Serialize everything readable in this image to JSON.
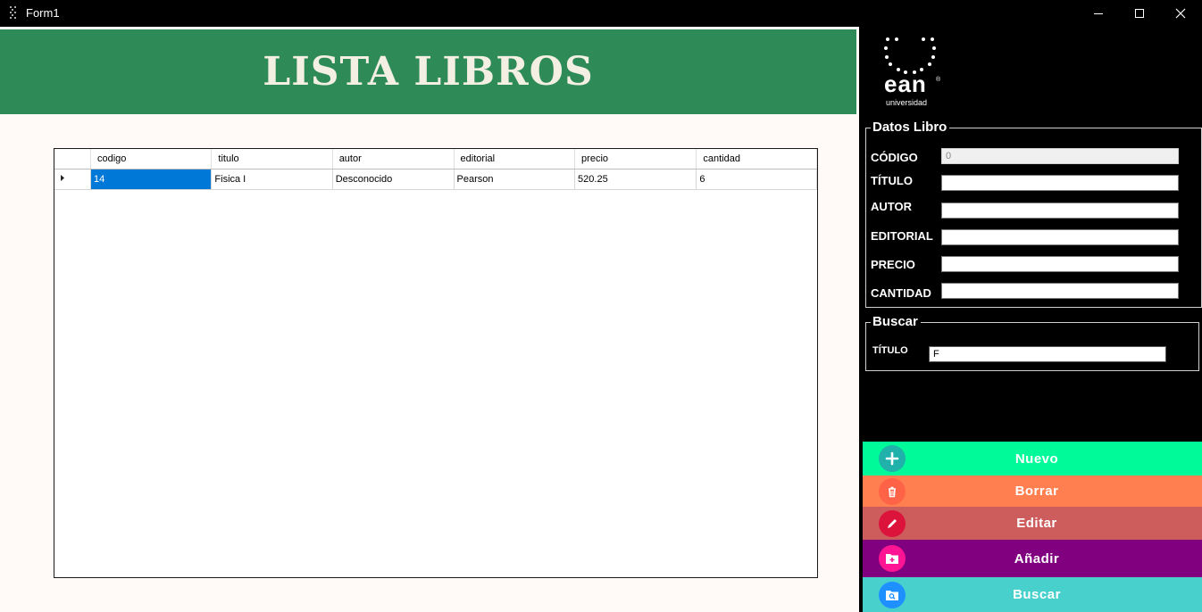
{
  "window": {
    "title": "Form1",
    "icon": "form-app-icon",
    "controls": [
      "minimize-icon",
      "maximize-icon",
      "close-icon"
    ]
  },
  "header": {
    "title": "LISTA LIBROS",
    "color": "#2e8b57"
  },
  "grid": {
    "columns": [
      "codigo",
      "titulo",
      "autor",
      "editorial",
      "precio",
      "cantidad"
    ],
    "rows": [
      {
        "codigo": "14",
        "titulo": "Fisica I",
        "autor": "Desconocido",
        "editorial": "Pearson",
        "precio": "520.25",
        "cantidad": "6"
      }
    ],
    "selection_color": "#0078d7"
  },
  "logo": {
    "text": "ean",
    "subtext": "universidad",
    "mark": "®"
  },
  "datos_libro": {
    "legend": "Datos Libro",
    "fields": [
      {
        "label": "CÓDIGO",
        "value": "0"
      },
      {
        "label": "TÍTULO",
        "value": ""
      },
      {
        "label": "AUTOR",
        "value": ""
      },
      {
        "label": "EDITORIAL",
        "value": ""
      },
      {
        "label": "PRECIO",
        "value": ""
      },
      {
        "label": "CANTIDAD",
        "value": ""
      }
    ]
  },
  "buscar": {
    "legend": "Buscar",
    "label": "TÍTULO",
    "value": "F"
  },
  "buttons": [
    {
      "label": "Nuevo",
      "color": "#00fa9a",
      "icon": "plus-icon",
      "icon_color": "#20b2aa"
    },
    {
      "label": "Borrar",
      "color": "#ff7f50",
      "icon": "trash-icon",
      "icon_color": "#ff6347"
    },
    {
      "label": "Editar",
      "color": "#cd5c5c",
      "icon": "pencil-icon",
      "icon_color": "#dc143c"
    },
    {
      "label": "Añadir",
      "color": "#800080",
      "icon": "folder-add-icon",
      "icon_color": "#ff1493"
    },
    {
      "label": "Buscar",
      "color": "#48d1cc",
      "icon": "folder-search-icon",
      "icon_color": "#1e90ff"
    }
  ]
}
